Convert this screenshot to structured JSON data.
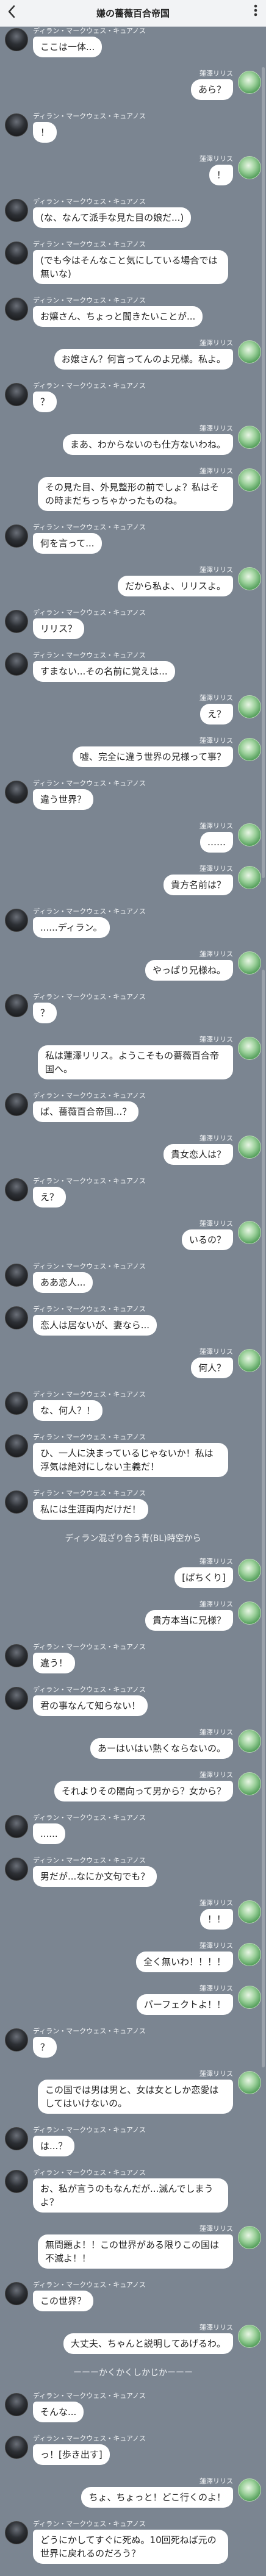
{
  "header": {
    "back_icon": "chevron-left-icon",
    "title": "嫌の薔薇百合帝国",
    "more_icon": "vertical-dots-icon"
  },
  "names": {
    "dylan": "ディラン・マークウェス・キュアノス",
    "lily": "蓮澤リリス"
  },
  "messages": [
    {
      "s": "d",
      "t": "ここは一体..."
    },
    {
      "s": "l",
      "t": "あら？"
    },
    {
      "s": "d",
      "t": "！"
    },
    {
      "s": "l",
      "t": "！"
    },
    {
      "s": "d",
      "t": "(な、なんて派手な見た目の娘だ...)"
    },
    {
      "s": "d",
      "t": "(でも今はそんなこと気にしている場合では無いな)"
    },
    {
      "s": "d",
      "t": "お嬢さん、ちょっと聞きたいことが..."
    },
    {
      "s": "l",
      "t": "お嬢さん？何言ってんのよ兄様。私よ。"
    },
    {
      "s": "d",
      "t": "？"
    },
    {
      "s": "l",
      "t": "まあ、わからないのも仕方ないわね。"
    },
    {
      "s": "l",
      "t": "その見た目、外見整形の前でしょ？私はその時まだちっちゃかったものね。"
    },
    {
      "s": "d",
      "t": "何を言って..."
    },
    {
      "s": "l",
      "t": "だから私よ、リリスよ。"
    },
    {
      "s": "d",
      "t": "リリス？"
    },
    {
      "s": "d",
      "t": "すまない...その名前に覚えは..."
    },
    {
      "s": "l",
      "t": "え？"
    },
    {
      "s": "l",
      "t": "嘘、完全に違う世界の兄様って事？"
    },
    {
      "s": "d",
      "t": "違う世界？"
    },
    {
      "s": "l",
      "t": "……"
    },
    {
      "s": "l",
      "t": "貴方名前は？"
    },
    {
      "s": "d",
      "t": "......ディラン。"
    },
    {
      "s": "l",
      "t": "やっぱり兄様ね。"
    },
    {
      "s": "d",
      "t": "？"
    },
    {
      "s": "l",
      "t": "私は蓮澤リリス。ようこそもの薔薇百合帝国へ。"
    },
    {
      "s": "d",
      "t": "ば、薔薇百合帝国...？"
    },
    {
      "s": "l",
      "t": "貴女恋人は？"
    },
    {
      "s": "d",
      "t": "え？"
    },
    {
      "s": "l",
      "t": "いるの？"
    },
    {
      "s": "d",
      "t": "ああ恋人..."
    },
    {
      "s": "d",
      "t": "恋人は居ないが、妻なら..."
    },
    {
      "s": "l",
      "t": "何人？"
    },
    {
      "s": "d",
      "t": "な、何人？！"
    },
    {
      "s": "d",
      "t": "ひ、一人に決まっているじゃないか！私は浮気は絶対にしない主義だ！"
    },
    {
      "s": "d",
      "t": "私には生涯両内だけだ！"
    },
    {
      "div": "ディラン混ざり合う青(BL)時空から"
    },
    {
      "s": "l",
      "t": "[ぱちくり]"
    },
    {
      "s": "l",
      "t": "貴方本当に兄様？"
    },
    {
      "s": "d",
      "t": "違う！"
    },
    {
      "s": "d",
      "t": "君の事なんて知らない！"
    },
    {
      "s": "l",
      "t": "あーはいはい熱くならないの。"
    },
    {
      "s": "l",
      "t": "それよりその陽向って男から？女から？"
    },
    {
      "s": "d",
      "t": "......"
    },
    {
      "s": "d",
      "t": "男だが...なにか文句でも？"
    },
    {
      "s": "l",
      "t": "！！"
    },
    {
      "s": "l",
      "t": "全く無いわ！！！！"
    },
    {
      "s": "l",
      "t": "パーフェクトよ！！"
    },
    {
      "s": "d",
      "t": "？"
    },
    {
      "s": "l",
      "t": "この国では男は男と、女は女としか恋愛はしてはいけないの。"
    },
    {
      "s": "d",
      "t": "は...？"
    },
    {
      "s": "d",
      "t": "お、私が言うのもなんだが...滅んでしまうよ？"
    },
    {
      "s": "l",
      "t": "無問題よ！！この世界がある限りこの国は不滅よ！！"
    },
    {
      "s": "d",
      "t": "この世界？"
    },
    {
      "s": "l",
      "t": "大丈夫、ちゃんと説明してあげるわ。"
    },
    {
      "div": "ーーーかくかくしかじかーーー"
    },
    {
      "s": "d",
      "t": "そんな..."
    },
    {
      "s": "d",
      "t": "っ！[歩き出す]"
    },
    {
      "s": "l",
      "t": "ちょ、ちょっと！どこ行くのよ！"
    },
    {
      "s": "d",
      "t": "どうにかしてすぐに死ぬ。10回死ねば元の世界に戻れるのだろう？"
    }
  ],
  "colors": {
    "background": "#7b8591",
    "bubble": "#ffffff",
    "name_text": "#f4f6f8"
  }
}
